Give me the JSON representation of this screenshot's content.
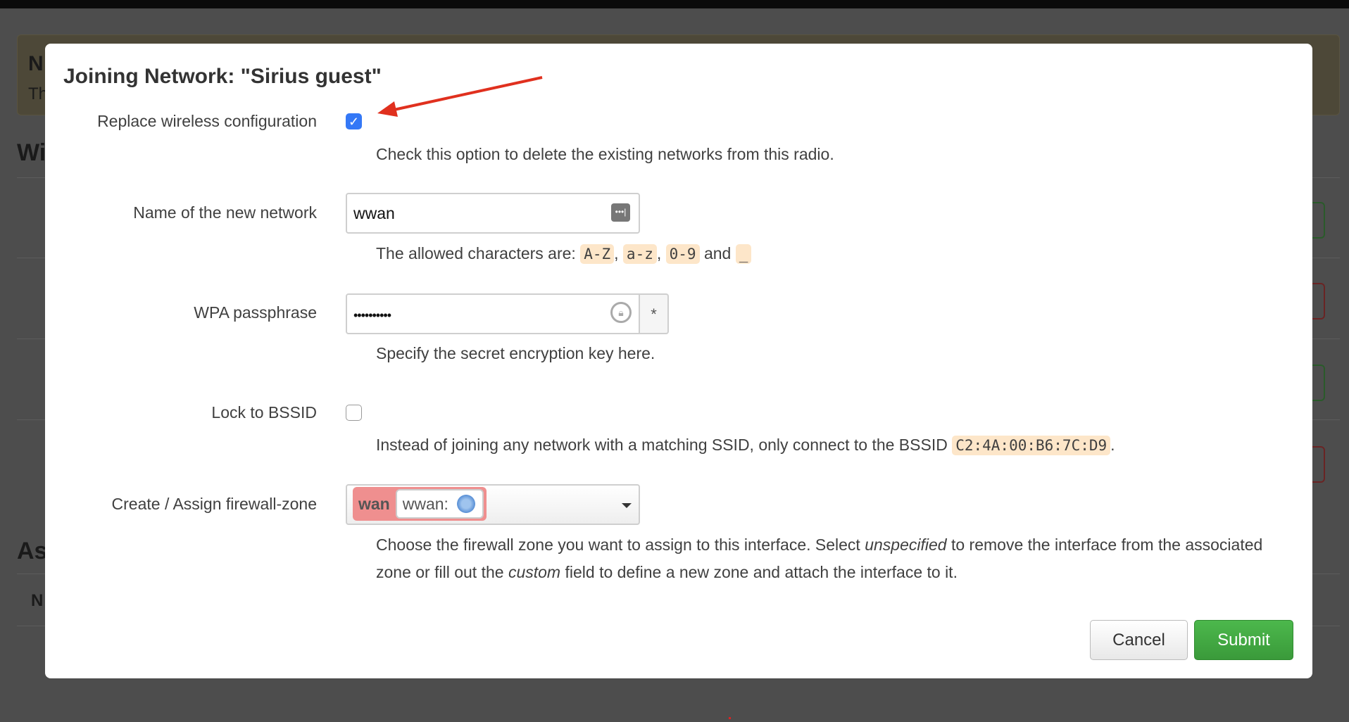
{
  "background": {
    "alert_heading": "N",
    "alert_text": "Th",
    "section1": "Wi",
    "section2": "As",
    "table_header": "N"
  },
  "modal": {
    "title": "Joining Network: \"Sirius guest\"",
    "replace": {
      "label": "Replace wireless configuration",
      "checked": true,
      "desc": "Check this option to delete the existing networks from this radio."
    },
    "name": {
      "label": "Name of the new network",
      "value": "wwan",
      "desc_prefix": "The allowed characters are:",
      "codes": [
        "A-Z",
        "a-z",
        "0-9",
        "_"
      ],
      "sep": ",",
      "and": "and"
    },
    "wpa": {
      "label": "WPA passphrase",
      "value": "••••••••••",
      "desc": "Specify the secret encryption key here.",
      "reveal": "*"
    },
    "bssid": {
      "label": "Lock to BSSID",
      "checked": false,
      "desc_prefix": "Instead of joining any network with a matching SSID, only connect to the BSSID",
      "bssid": "C2:4A:00:B6:7C:D9",
      "desc_suffix": "."
    },
    "zone": {
      "label": "Create / Assign firewall-zone",
      "zone_name": "wan",
      "interface": "wwan:",
      "zone_color": "#ef8f8f",
      "desc1": "Choose the firewall zone you want to assign to this interface. Select ",
      "em1": "unspecified",
      "desc2": " to remove the interface from the associated zone or fill out the ",
      "em2": "custom",
      "desc3": " field to define a new zone and attach the interface to it."
    },
    "cancel": "Cancel",
    "submit": "Submit"
  },
  "colors": {
    "accent": "#3478f6",
    "submit": "#3fa63f",
    "arrow": "#e0301e",
    "code_bg": "#fde6c9"
  }
}
